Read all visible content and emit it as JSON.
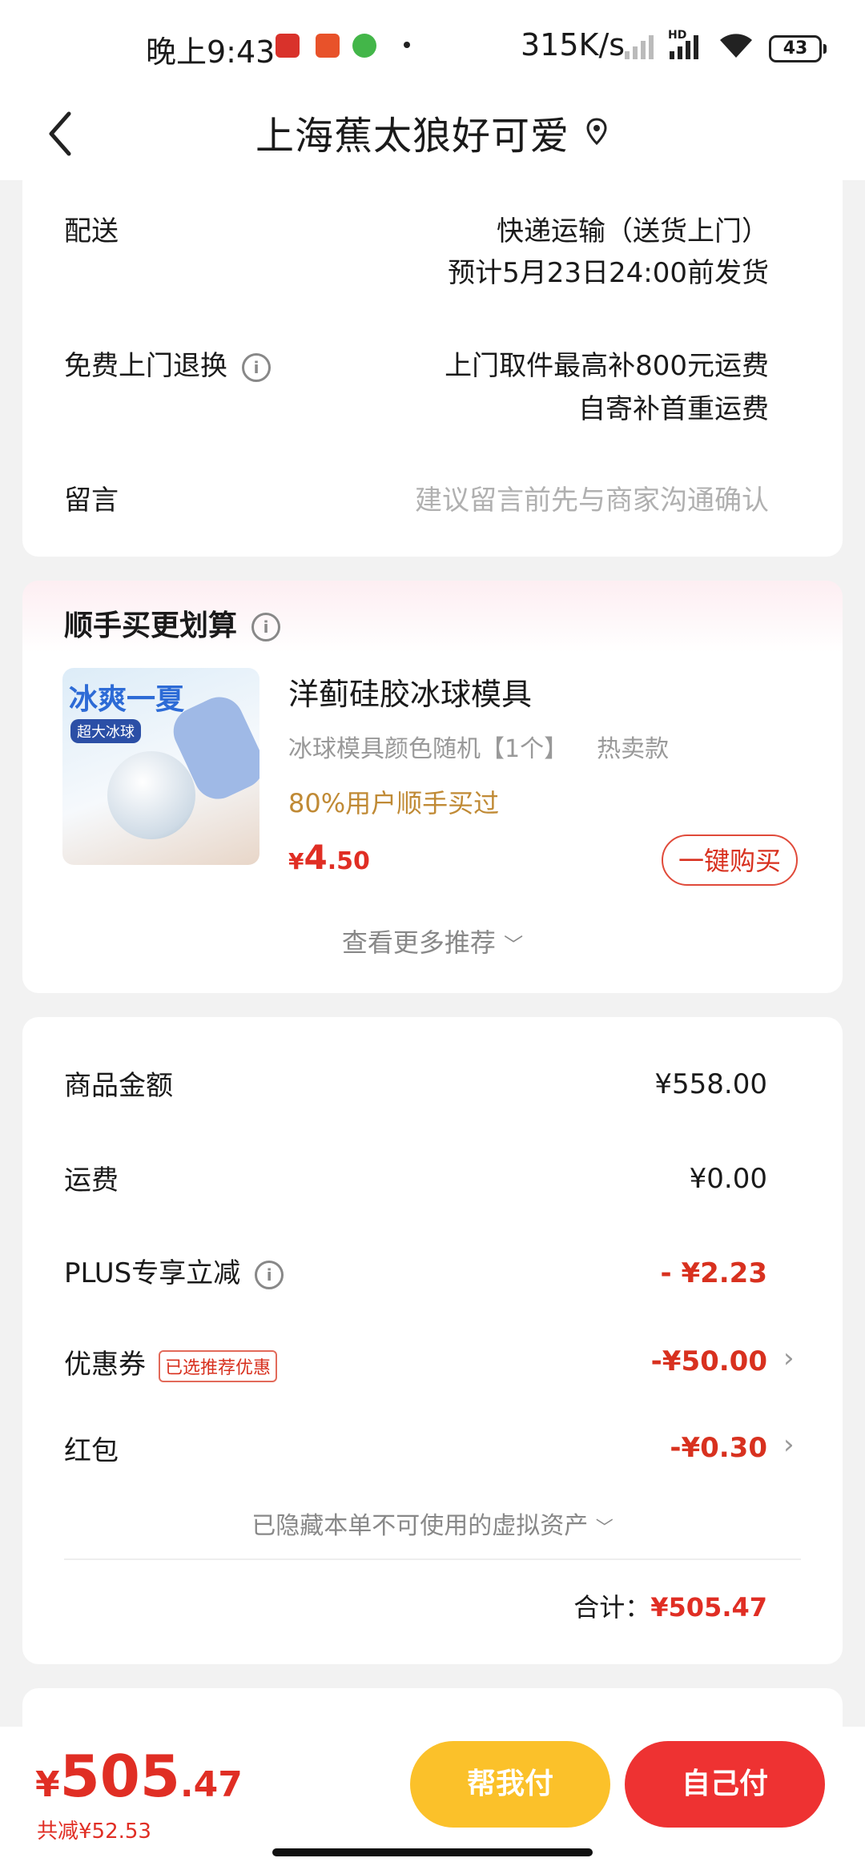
{
  "status_bar": {
    "time": "晚上9:43",
    "speed": "315K/s",
    "network": "HD",
    "battery": "43"
  },
  "nav": {
    "title": "上海蕉太狼好可爱"
  },
  "delivery": {
    "label": "配送",
    "method": "快递运输（送货上门）",
    "eta": "预计5月23日24:00前发货",
    "return_label": "免费上门退换",
    "return_line1": "上门取件最高补800元运费",
    "return_line2": "自寄补首重运费",
    "message_label": "留言",
    "message_placeholder": "建议留言前先与商家沟通确认"
  },
  "addon": {
    "title": "顺手买更划算",
    "product_name": "洋蓟硅胶冰球模具",
    "spec": "冰球模具颜色随机【1个】",
    "hot": "热卖款",
    "buyers": "80%用户顺手买过",
    "yen": "¥",
    "price_int": "4",
    "price_dec": ".50",
    "buy_btn": "一键购买",
    "more": "查看更多推荐",
    "image_text1": "冰爽一夏",
    "image_text2": "超大冰球"
  },
  "summary": {
    "goods_label": "商品金额",
    "goods_value": "¥558.00",
    "ship_label": "运费",
    "ship_value": "¥0.00",
    "plus_label": "PLUS专享立减",
    "plus_value": "- ¥2.23",
    "coupon_label": "优惠券",
    "coupon_tag": "已选推荐优惠",
    "coupon_value": "-¥50.00",
    "redpack_label": "红包",
    "redpack_value": "-¥0.30",
    "hidden_note": "已隐藏本单不可使用的虚拟资产",
    "total_label": "合计：",
    "total_value": "¥505.47"
  },
  "bottom": {
    "yen": "¥",
    "int": "505",
    "dec": ".47",
    "saved": "共减¥52.53",
    "help_pay": "帮我付",
    "self_pay": "自己付"
  },
  "colors": {
    "accent_red": "#e02e24",
    "help_yellow": "#fbc12a",
    "self_red": "#ee3232",
    "buyers_gold": "#c08a35"
  }
}
